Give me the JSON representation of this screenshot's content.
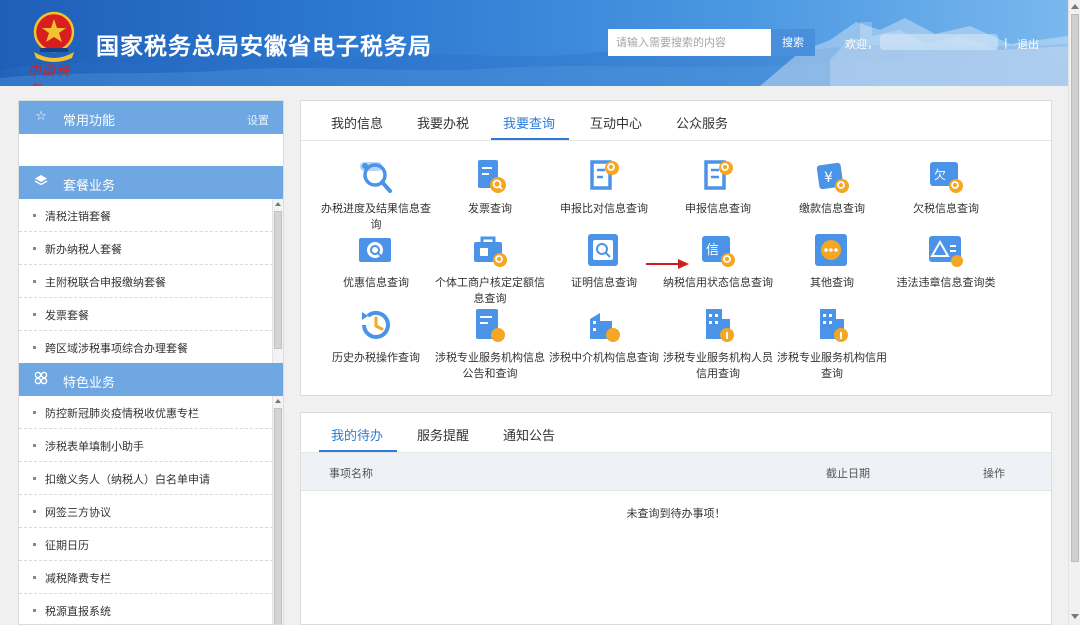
{
  "header": {
    "site_title": "国家税务总局安徽省电子税务局",
    "emblem_signature": "中国税务",
    "search_placeholder": "请输入需要搜索的内容",
    "search_button": "搜索",
    "welcome": "欢迎，",
    "separator": "|",
    "logout": "退出"
  },
  "sidebar": {
    "common": {
      "title": "常用功能",
      "settings": "设置"
    },
    "package": {
      "title": "套餐业务",
      "items": [
        "清税注销套餐",
        "新办纳税人套餐",
        "主附税联合申报缴纳套餐",
        "发票套餐",
        "跨区域涉税事项综合办理套餐"
      ]
    },
    "special": {
      "title": "特色业务",
      "items": [
        "防控新冠肺炎疫情税收优惠专栏",
        "涉税表单填制小助手",
        "扣缴义务人（纳税人）白名单申请",
        "网签三方协议",
        "征期日历",
        "减税降费专栏",
        "税源直报系统"
      ]
    }
  },
  "main_tabs": [
    "我的信息",
    "我要办税",
    "我要查询",
    "互动中心",
    "公众服务"
  ],
  "active_main_tab": "我要查询",
  "query_functions": [
    {
      "label": "办税进度及结果信息查询",
      "icon": "search-progress-icon"
    },
    {
      "label": "发票查询",
      "icon": "invoice-search-icon"
    },
    {
      "label": "申报比对信息查询",
      "icon": "declaration-compare-icon"
    },
    {
      "label": "申报信息查询",
      "icon": "declaration-search-icon"
    },
    {
      "label": "缴款信息查询",
      "icon": "payment-search-icon"
    },
    {
      "label": "欠税信息查询",
      "icon": "arrears-search-icon"
    },
    {
      "label": "优惠信息查询",
      "icon": "preferential-search-icon"
    },
    {
      "label": "个体工商户核定定额信息查询",
      "icon": "business-quota-icon"
    },
    {
      "label": "证明信息查询",
      "icon": "certificate-search-icon"
    },
    {
      "label": "纳税信用状态信息查询",
      "icon": "credit-status-icon"
    },
    {
      "label": "其他查询",
      "icon": "other-search-icon"
    },
    {
      "label": "违法违章信息查询类",
      "icon": "violation-warning-icon"
    },
    {
      "label": "历史办税操作查询",
      "icon": "history-clock-icon"
    },
    {
      "label": "涉税专业服务机构信息公告和查询",
      "icon": "agency-announce-icon"
    },
    {
      "label": "涉税中介机构信息查询",
      "icon": "intermediary-search-icon"
    },
    {
      "label": "涉税专业服务机构人员信用查询",
      "icon": "agency-staff-credit-icon"
    },
    {
      "label": "涉税专业服务机构信用查询",
      "icon": "agency-credit-icon"
    }
  ],
  "todo": {
    "tabs": [
      "我的待办",
      "服务提醒",
      "通知公告"
    ],
    "active_tab": "我的待办",
    "columns": [
      "事项名称",
      "截止日期",
      "操作"
    ],
    "empty_message": "未查询到待办事项！"
  },
  "colors": {
    "brand_blue": "#2d7bd6",
    "sidebar_header": "#6ea7e2",
    "icon_blue": "#4b93e6",
    "icon_orange": "#f5a623",
    "arrow_red": "#cc1f1f"
  }
}
